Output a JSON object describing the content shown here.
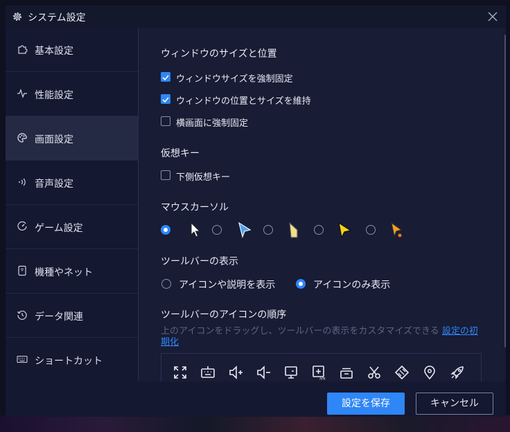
{
  "colors": {
    "accent": "#2f86f6",
    "dialog_bg": "#181c35",
    "sidebar_bg": "#141830",
    "active_item_bg": "#252a44",
    "hint_text": "#5d6483"
  },
  "window": {
    "title": "システム設定",
    "title_icon": "gear-icon",
    "close_icon": "close-icon"
  },
  "sidebar": {
    "items": [
      {
        "label": "基本設定",
        "icon": "puzzle-icon",
        "active": false
      },
      {
        "label": "性能設定",
        "icon": "pulse-icon",
        "active": false
      },
      {
        "label": "画面設定",
        "icon": "palette-icon",
        "active": true
      },
      {
        "label": "音声設定",
        "icon": "sound-wave-icon",
        "active": false
      },
      {
        "label": "ゲーム設定",
        "icon": "gauge-icon",
        "active": false
      },
      {
        "label": "機種やネット",
        "icon": "device-icon",
        "active": false
      },
      {
        "label": "データ関連",
        "icon": "history-icon",
        "active": false
      },
      {
        "label": "ショートカット",
        "icon": "keyboard-icon",
        "active": false
      }
    ]
  },
  "window_size": {
    "heading": "ウィンドウのサイズと位置",
    "options": [
      {
        "label": "ウィンドウサイズを強制固定",
        "checked": true
      },
      {
        "label": "ウィンドウの位置とサイズを維持",
        "checked": true
      },
      {
        "label": "横画面に強制固定",
        "checked": false
      }
    ]
  },
  "virtual_keys": {
    "heading": "仮想キー",
    "options": [
      {
        "label": "下側仮想キー",
        "checked": false
      }
    ]
  },
  "mouse_cursor": {
    "heading": "マウスカーソル",
    "selected_index": 0,
    "options": [
      {
        "icon": "cursor-default-icon"
      },
      {
        "icon": "cursor-blue-icon"
      },
      {
        "icon": "cursor-yellow-pencil-icon"
      },
      {
        "icon": "cursor-yellow-icon"
      },
      {
        "icon": "cursor-orange-icon"
      }
    ]
  },
  "toolbar_display": {
    "heading": "ツールバーの表示",
    "options": [
      {
        "label": "アイコンや説明を表示",
        "selected": false
      },
      {
        "label": "アイコンのみ表示",
        "selected": true
      }
    ]
  },
  "toolbar_order": {
    "heading": "ツールバーのアイコンの順序",
    "hint": "上のアイコンをドラッグし、ツールバーの表示をカスタマイズできる",
    "reset_link": "設定の初期化",
    "icons": [
      "fullscreen-icon",
      "keyboard-mapping-icon",
      "volume-up-icon",
      "volume-down-icon",
      "screen-icon",
      "apk-install-icon",
      "multi-instance-icon",
      "scissors-icon",
      "rotate-icon",
      "location-pin-icon",
      "rocket-icon"
    ]
  },
  "footer": {
    "save_label": "設定を保存",
    "cancel_label": "キャンセル"
  }
}
